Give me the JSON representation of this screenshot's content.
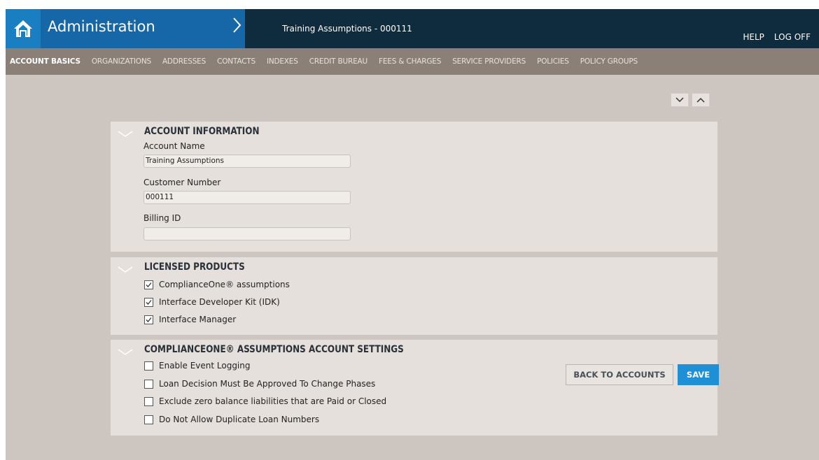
{
  "header": {
    "app_title": "Administration",
    "breadcrumb_title": "Training Assumptions - 000111",
    "help_label": "HELP",
    "logoff_label": "LOG OFF"
  },
  "nav": {
    "items": [
      {
        "label": "ACCOUNT BASICS",
        "active": true
      },
      {
        "label": "ORGANIZATIONS"
      },
      {
        "label": "ADDRESSES"
      },
      {
        "label": "CONTACTS"
      },
      {
        "label": "INDEXES"
      },
      {
        "label": "CREDIT BUREAU"
      },
      {
        "label": "FEES & CHARGES"
      },
      {
        "label": "SERVICE PROVIDERS"
      },
      {
        "label": "POLICIES"
      },
      {
        "label": "POLICY GROUPS"
      }
    ]
  },
  "account_info": {
    "title": "ACCOUNT INFORMATION",
    "account_name_label": "Account Name",
    "account_name_value": "Training Assumptions",
    "customer_number_label": "Customer Number",
    "customer_number_value": "000111",
    "billing_id_label": "Billing ID",
    "billing_id_value": ""
  },
  "licensed_products": {
    "title": "LICENSED PRODUCTS",
    "items": [
      {
        "label": "ComplianceOne® assumptions",
        "checked": true
      },
      {
        "label": "Interface Developer Kit (IDK)",
        "checked": true
      },
      {
        "label": "Interface Manager",
        "checked": true
      }
    ]
  },
  "settings": {
    "title": "COMPLIANCEONE® ASSUMPTIONS ACCOUNT SETTINGS",
    "items": [
      {
        "label": "Enable Event Logging",
        "checked": false
      },
      {
        "label": "Loan Decision Must Be Approved To Change Phases",
        "checked": false
      },
      {
        "label": "Exclude zero balance liabilities that are Paid or Closed",
        "checked": false
      },
      {
        "label": "Do Not Allow Duplicate Loan Numbers",
        "checked": false
      }
    ]
  },
  "actions": {
    "back_label": "BACK TO ACCOUNTS",
    "save_label": "SAVE"
  },
  "colors": {
    "topbar": "#0f2b3e",
    "title_block": "#1567a8",
    "nav": "#8a8078",
    "content_bg": "#cdc6c0",
    "panel_bg": "#e5e0dc",
    "save_button": "#1f8fd6"
  },
  "icons": {
    "home": "home-icon",
    "breadcrumb": "chevron-right-icon",
    "expand_all": "chevron-down-icon",
    "collapse_all": "chevron-up-icon",
    "panel_toggle": "chevron-down-icon",
    "checkbox_checked": "checkmark-icon"
  }
}
